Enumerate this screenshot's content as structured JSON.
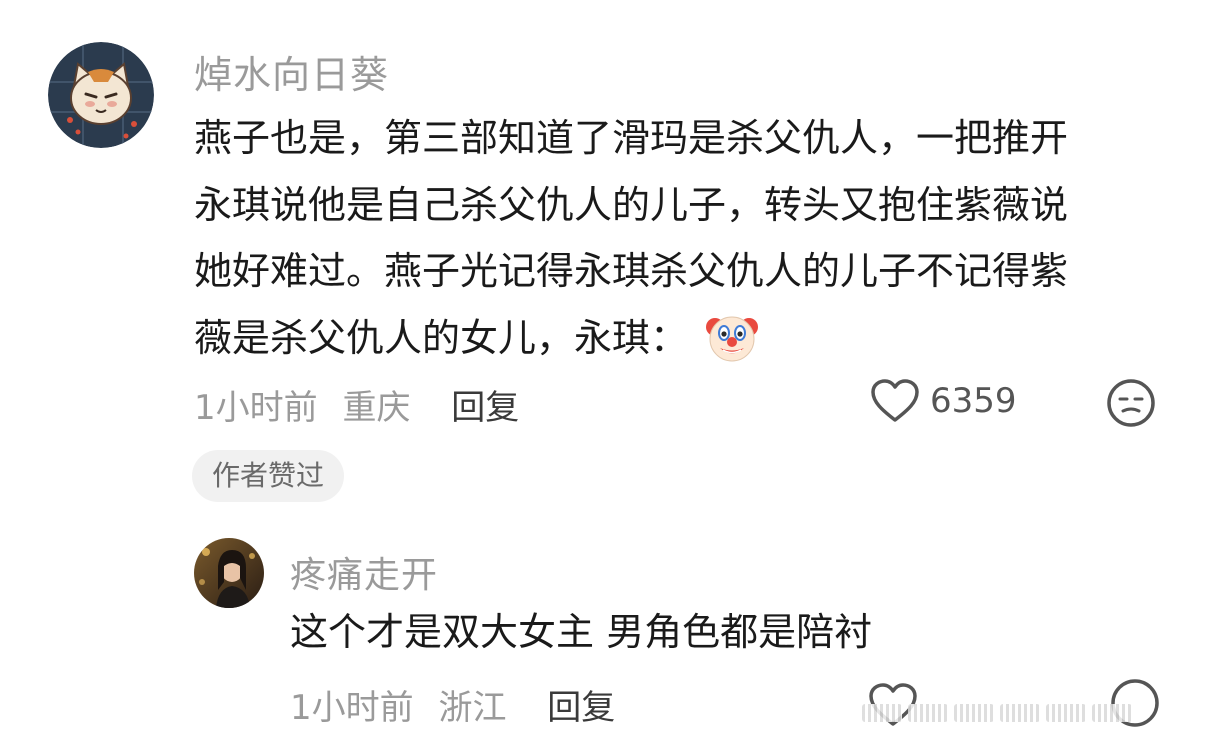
{
  "comment": {
    "username": "焯水向日葵",
    "avatar": "cat-cartoon-avatar",
    "text_lines": [
      "燕子也是，第三部知道了滑玛是杀父仇人，一把推开",
      "永琪说他是自己杀父仇人的儿子，转头又抱住紫薇说",
      "她好难过。燕子光记得永琪杀父仇人的儿子不记得紫",
      "薇是杀父仇人的女儿，永琪："
    ],
    "emoji": "clown-face-icon",
    "time": "1小时前",
    "location": "重庆",
    "reply_label": "回复",
    "like_count": "6359",
    "author_badge": "作者赞过"
  },
  "reply": {
    "username": "疼痛走开",
    "avatar": "photo-avatar",
    "text": "这个才是双大女主 男角色都是陪衬",
    "time": "1小时前",
    "location": "浙江",
    "reply_label": "回复"
  },
  "colors": {
    "secondary_text": "#9a9a9a",
    "primary_text": "#1a1a1a",
    "badge_bg": "#f1f1f1"
  }
}
